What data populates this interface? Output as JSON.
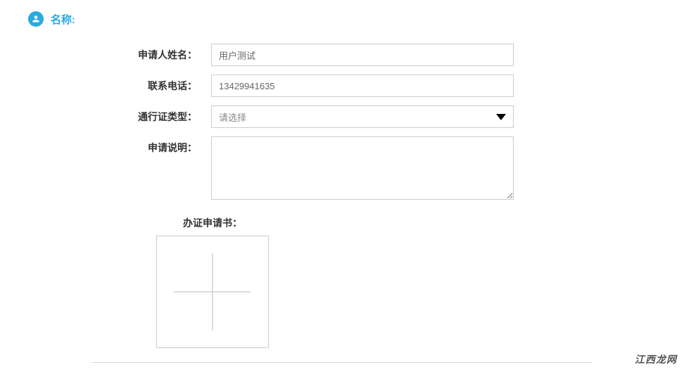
{
  "section": {
    "title": "名称:"
  },
  "form": {
    "applicant_name": {
      "label": "申请人姓名：",
      "value": "用户测试"
    },
    "phone": {
      "label": "联系电话：",
      "value": "13429941635"
    },
    "pass_type": {
      "label": "通行证类型：",
      "placeholder": "请选择"
    },
    "description": {
      "label": "申请说明：",
      "value": ""
    },
    "upload": {
      "label": "办证申请书："
    }
  },
  "watermark": "江西龙网"
}
